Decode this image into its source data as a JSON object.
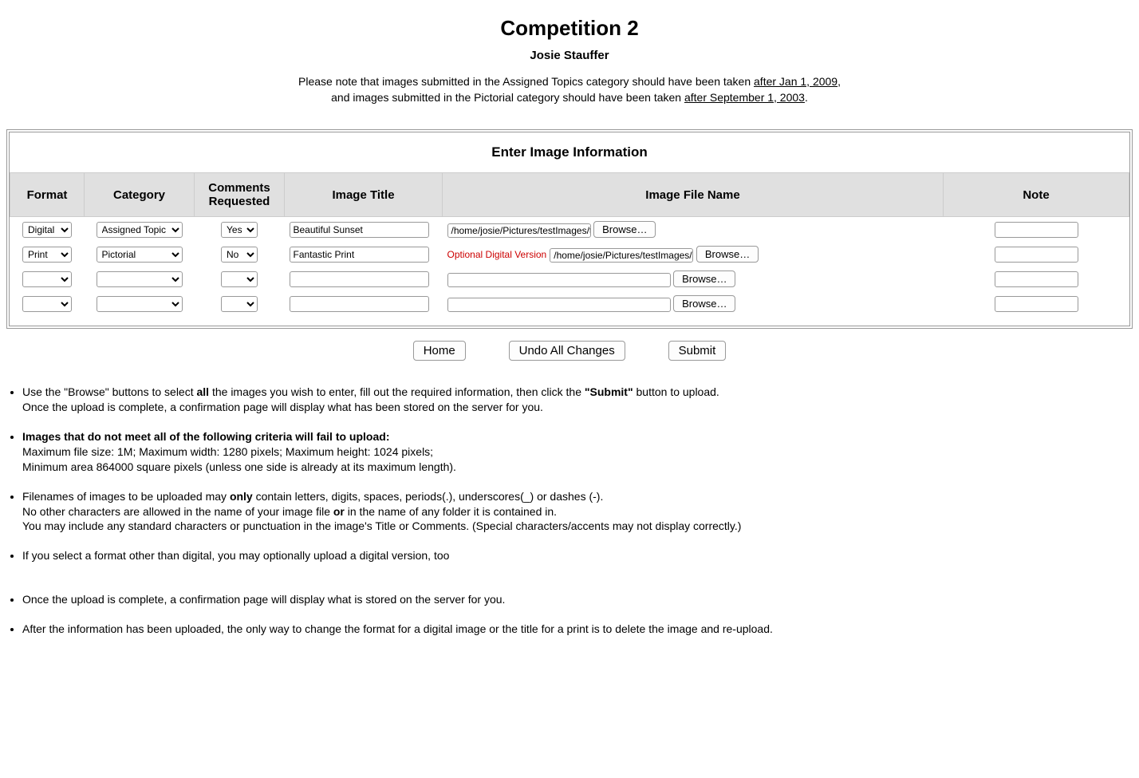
{
  "header": {
    "title": "Competition 2",
    "author": "Josie Stauffer",
    "notice_pre": "Please note that images submitted in the Assigned Topics category should have been taken ",
    "notice_u1": "after Jan 1, 2009",
    "notice_mid": ",\nand images submitted in the Pictorial category should have been taken ",
    "notice_u2": "after September 1, 2003",
    "notice_post": "."
  },
  "form": {
    "section_title": "Enter Image Information",
    "headers": {
      "format": "Format",
      "category": "Category",
      "comments": "Comments Requested",
      "title": "Image Title",
      "filename": "Image File Name",
      "note": "Note"
    },
    "browse_label": "Browse…",
    "optional_label": "Optional Digital Version",
    "rows": [
      {
        "format": "Digital",
        "category": "Assigned Topic",
        "comments": "Yes",
        "title": "Beautiful Sunset",
        "file": "/home/josie/Pictures/testImages/tester.jpg",
        "has_optional_label": false,
        "note": ""
      },
      {
        "format": "Print",
        "category": "Pictorial",
        "comments": "No",
        "title": "Fantastic Print",
        "file": "/home/josie/Pictures/testImages/xcfImage.jp",
        "has_optional_label": true,
        "note": ""
      },
      {
        "format": "",
        "category": "",
        "comments": "",
        "title": "",
        "file": "",
        "has_optional_label": false,
        "note": ""
      },
      {
        "format": "",
        "category": "",
        "comments": "",
        "title": "",
        "file": "",
        "has_optional_label": false,
        "note": ""
      }
    ]
  },
  "buttons": {
    "home": "Home",
    "undo": "Undo All Changes",
    "submit": "Submit"
  },
  "instructions": {
    "i1a": "Use the \"Browse\" buttons to select ",
    "i1b": "all",
    "i1c": " the images you wish to enter, fill out the required information, then click the ",
    "i1d": "\"Submit\"",
    "i1e": " button to upload.\nOnce the upload is complete, a confirmation page will display what has been stored on the server for you.",
    "i2a": "Images that do not meet all of the following criteria will fail to upload:",
    "i2b": "Maximum file size: 1M;   Maximum width: 1280 pixels;   Maximum height: 1024 pixels;\nMinimum area 864000 square pixels (unless one side is already at its maximum length).",
    "i3a": "Filenames of images to be uploaded may ",
    "i3b": "only",
    "i3c": " contain letters, digits, spaces, periods(.), underscores(_) or dashes (-).\nNo other characters are allowed in the name of your image file ",
    "i3d": "or",
    "i3e": " in the name of any folder it is contained in.\nYou may include any standard characters or punctuation in the image's Title or Comments. (Special characters/accents may not display correctly.)",
    "i4": "If you select a format other than digital, you may optionally upload a digital version, too",
    "i5": "Once the upload is complete, a confirmation page will display what is stored on the server for you.",
    "i6": "After the information has been uploaded, the only way to change the format for a digital image or the title for a print is to delete the image and re-upload."
  }
}
